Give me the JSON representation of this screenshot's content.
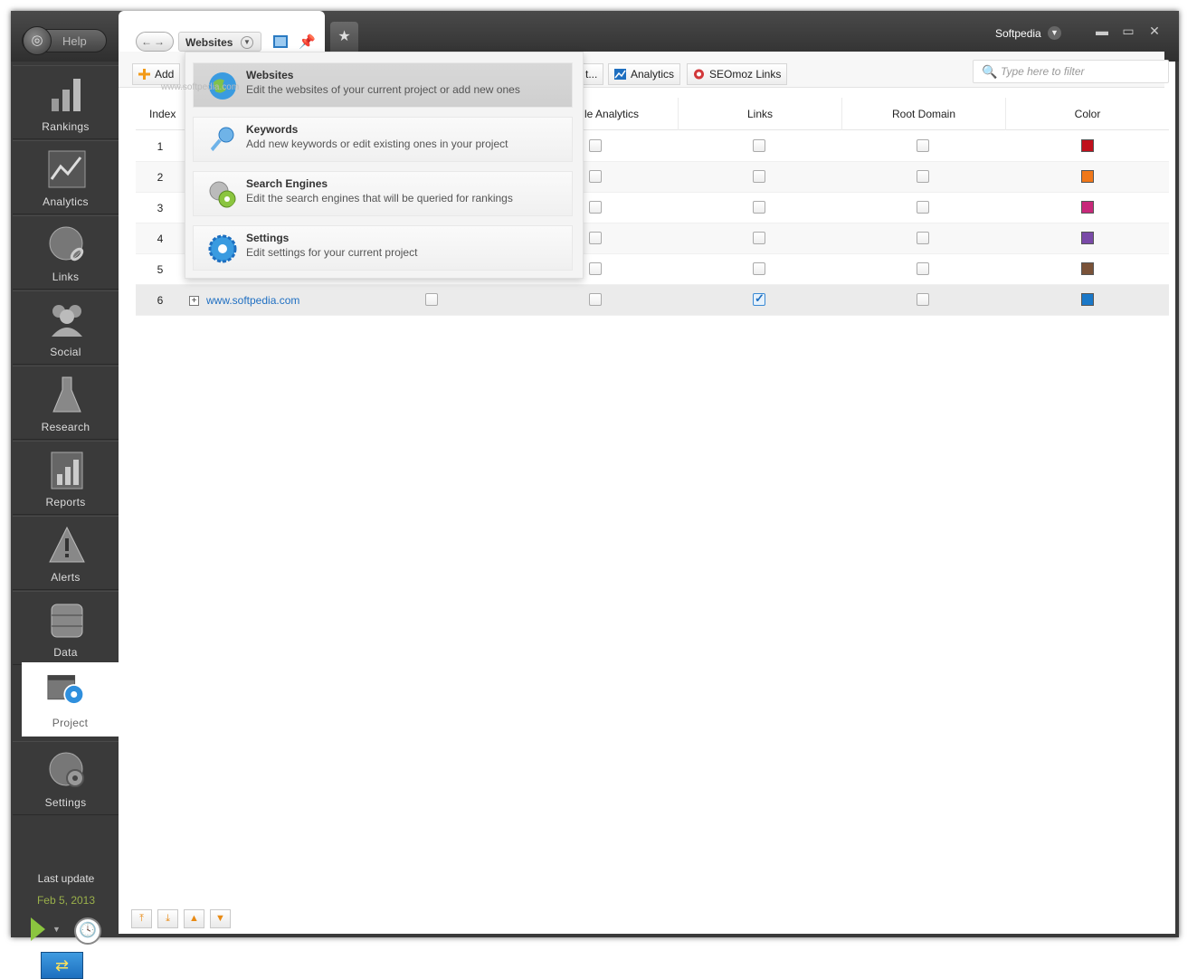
{
  "titlebar": {
    "help_label": "Help",
    "user_label": "Softpedia",
    "minimize": "▬",
    "maximize": "▭",
    "close": "✕"
  },
  "tab": {
    "breadcrumb": "Websites",
    "star": "★"
  },
  "sidebar": {
    "items": [
      {
        "label": "Rankings",
        "icon": "rankings-bars-icon"
      },
      {
        "label": "Analytics",
        "icon": "analytics-chart-icon"
      },
      {
        "label": "Links",
        "icon": "links-globe-chain-icon"
      },
      {
        "label": "Social",
        "icon": "social-people-icon"
      },
      {
        "label": "Research",
        "icon": "research-flask-icon"
      },
      {
        "label": "Reports",
        "icon": "reports-document-icon"
      },
      {
        "label": "Alerts",
        "icon": "alerts-warning-icon"
      },
      {
        "label": "Data",
        "icon": "data-database-icon"
      },
      {
        "label": "Project",
        "icon": "project-gear-icon"
      },
      {
        "label": "Settings",
        "icon": "settings-globe-gear-icon"
      }
    ],
    "last_update_label": "Last update",
    "last_update_date": "Feb 5, 2013"
  },
  "toolbar": {
    "add_label": "Add",
    "truncated_label": "t...",
    "analytics_label": "Analytics",
    "seomoz_label": "SEOmoz Links",
    "filter_placeholder": "Type here to filter"
  },
  "grid": {
    "columns": {
      "index": "Index",
      "analytics": "le Analytics",
      "links": "Links",
      "root_domain": "Root Domain",
      "color": "Color"
    },
    "rows": [
      {
        "index": "1",
        "site": "",
        "col_a": false,
        "analytics": false,
        "links": false,
        "root": false,
        "color": "#c0101c"
      },
      {
        "index": "2",
        "site": "",
        "col_a": false,
        "analytics": false,
        "links": false,
        "root": false,
        "color": "#f0781a"
      },
      {
        "index": "3",
        "site": "",
        "col_a": false,
        "analytics": false,
        "links": false,
        "root": false,
        "color": "#c8287a"
      },
      {
        "index": "4",
        "site": "",
        "col_a": false,
        "analytics": false,
        "links": false,
        "root": false,
        "color": "#7a4aa8"
      },
      {
        "index": "5",
        "site": "",
        "col_a": false,
        "analytics": false,
        "links": false,
        "root": false,
        "color": "#7a5238"
      },
      {
        "index": "6",
        "site": "www.softpedia.com",
        "col_a": false,
        "analytics": false,
        "links": true,
        "root": false,
        "color": "#1a78c8"
      }
    ]
  },
  "dropdown": {
    "items": [
      {
        "title": "Websites",
        "desc": "Edit the websites of your current project or add new ones"
      },
      {
        "title": "Keywords",
        "desc": "Add new keywords or edit existing ones in your project"
      },
      {
        "title": "Search Engines",
        "desc": "Edit the search engines that will be queried for rankings"
      },
      {
        "title": "Settings",
        "desc": "Edit settings for your current project"
      }
    ]
  },
  "watermark": "www.softpedia.com",
  "colors": {
    "sidebar_bg": "#3a3a3a",
    "link_blue": "#1f6fc2",
    "date_green": "#9ab04a"
  }
}
